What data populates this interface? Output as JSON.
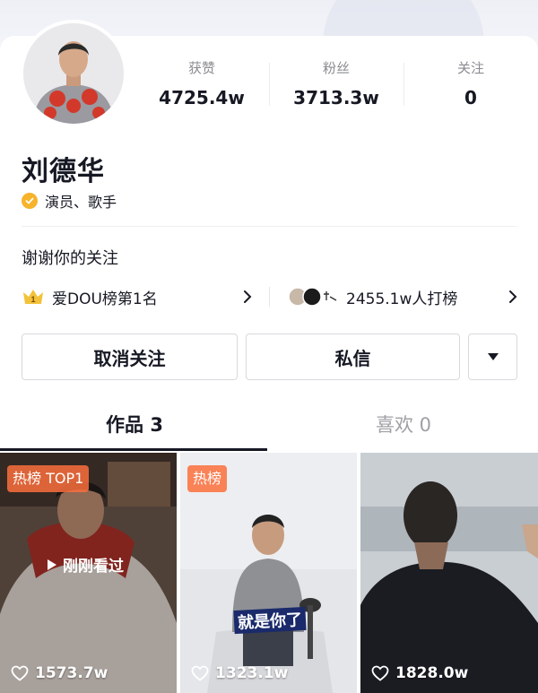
{
  "profile": {
    "name": "刘德华",
    "verification": "演员、歌手",
    "bio": "谢谢你的关注"
  },
  "stats": [
    {
      "label": "获赞",
      "value": "4725.4w"
    },
    {
      "label": "粉丝",
      "value": "3713.3w"
    },
    {
      "label": "关注",
      "value": "0"
    }
  ],
  "rank": {
    "left_badge_number": "1",
    "left_text": "爱DOU榜第1名",
    "right_text": "2455.1w人打榜"
  },
  "buttons": {
    "unfollow": "取消关注",
    "message": "私信"
  },
  "tabs": {
    "works": "作品 3",
    "likes": "喜欢 0"
  },
  "videos": [
    {
      "badge": "热榜 TOP1",
      "overlay": "刚刚看过",
      "likes": "1573.7w"
    },
    {
      "badge": "热榜",
      "caption": "就是你了",
      "likes": "1323.1w"
    },
    {
      "likes": "1828.0w"
    }
  ],
  "colors": {
    "verify_badge": "#f6b32c",
    "hot_badge": "#fa6e3c",
    "text_primary": "#161823",
    "text_secondary": "#8a8b91"
  }
}
